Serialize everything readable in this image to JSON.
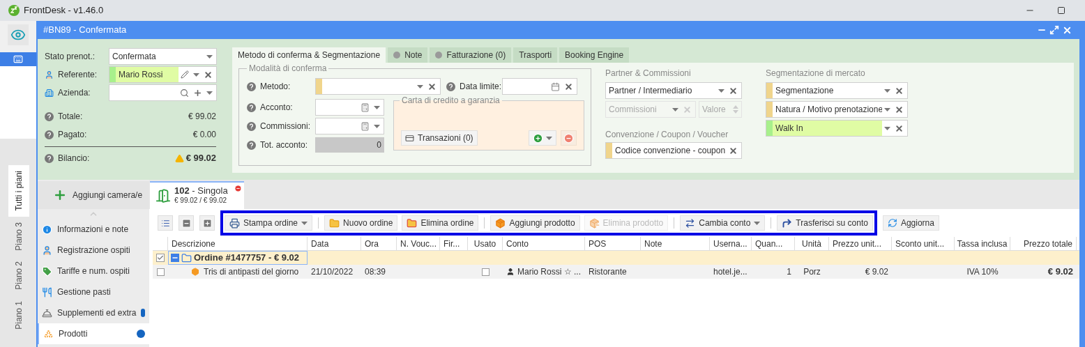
{
  "app": {
    "title": "FrontDesk - v1.46.0"
  },
  "floors": [
    {
      "label": "Tutti i piani",
      "selected": true
    },
    {
      "label": "Piano 3",
      "selected": false
    },
    {
      "label": "Piano 2",
      "selected": false
    },
    {
      "label": "Piano 1",
      "selected": false
    }
  ],
  "dialog": {
    "title": "#BN89 - Confermata"
  },
  "booking": {
    "status": {
      "label": "Stato prenot.:",
      "value": "Confermata"
    },
    "referente": {
      "label": "Referente:",
      "value": "Mario Rossi",
      "color": "#a8f08c"
    },
    "azienda": {
      "label": "Azienda:"
    },
    "totals": [
      {
        "label": "Totale:",
        "value": "€ 99.02"
      },
      {
        "label": "Pagato:",
        "value": "€ 0.00"
      }
    ],
    "balance": {
      "label": "Bilancio:",
      "value": "€ 99.02",
      "warning": true
    }
  },
  "tabs": [
    {
      "label": "Metodo di conferma & Segmentazione",
      "selected": true,
      "dot": false
    },
    {
      "label": "Note",
      "selected": false,
      "dot": true
    },
    {
      "label": "Fatturazione (0)",
      "selected": false,
      "dot": true
    },
    {
      "label": "Trasporti",
      "selected": false,
      "dot": false
    },
    {
      "label": "Booking Engine",
      "selected": false,
      "dot": false
    }
  ],
  "conferma": {
    "title": "Modalità di conferma",
    "metodo": {
      "label": "Metodo:",
      "color": "#f0d58c"
    },
    "data_limite": {
      "label": "Data limite:"
    },
    "acconto": {
      "label": "Acconto:"
    },
    "commissioni": {
      "label": "Commissioni:"
    },
    "tot_acconto": {
      "label": "Tot. acconto:",
      "value": "0"
    },
    "carta": {
      "title": "Carta di credito a garanzia",
      "transactions": "Transazioni (0)"
    }
  },
  "partner": {
    "title": "Partner & Commissioni",
    "partner": {
      "value": "Partner / Intermediario"
    },
    "commissioni": {
      "value": "Commissioni",
      "disabled": true
    },
    "valore": {
      "value": "Valore",
      "disabled": true
    }
  },
  "convenzione": {
    "title": "Convenzione / Coupon / Voucher",
    "code": {
      "value": "Codice convenzione - coupon",
      "color": "#f0d58c"
    }
  },
  "segmentazione": {
    "title": "Segmentazione di mercato",
    "fields": [
      {
        "value": "Segmentazione",
        "color": "#f0d58c",
        "highlighted": false
      },
      {
        "value": "Natura / Motivo prenotazione",
        "color": "#f0d58c",
        "highlighted": false
      },
      {
        "value": "Walk In",
        "color": "#a8f08c",
        "highlighted": true
      }
    ]
  },
  "sidebar": {
    "add_button": "Aggiungi camera/e",
    "items": [
      {
        "label": "Informazioni e note",
        "selected": false,
        "dot": false
      },
      {
        "label": "Registrazione ospiti",
        "selected": false,
        "dot": false
      },
      {
        "label": "Tariffe e num. ospiti",
        "selected": false,
        "dot": false
      },
      {
        "label": "Gestione pasti",
        "selected": false,
        "dot": false
      },
      {
        "label": "Supplementi ed extra",
        "selected": false,
        "dot": true
      },
      {
        "label": "Prodotti",
        "selected": true,
        "dot": true
      }
    ]
  },
  "room": {
    "title": "**102** - Singola",
    "amounts": "€ 99.02 / € 99.02"
  },
  "toolbar": {
    "groups": [
      [
        {
          "label": "Stampa ordine",
          "menu": true,
          "disabled": false
        }
      ],
      [
        {
          "label": "Nuovo ordine",
          "menu": false,
          "disabled": false
        },
        {
          "label": "Elimina ordine",
          "menu": false,
          "disabled": false
        }
      ],
      [
        {
          "label": "Aggiungi prodotto",
          "menu": false,
          "disabled": false
        },
        {
          "label": "Elimina prodotto",
          "menu": false,
          "disabled": true
        }
      ],
      [
        {
          "label": "Cambia conto",
          "menu": true,
          "disabled": false
        }
      ],
      [
        {
          "label": "Trasferisci su conto",
          "menu": false,
          "disabled": false
        }
      ]
    ],
    "refresh": "Aggiorna"
  },
  "table": {
    "columns": [
      "Descrizione",
      "Data",
      "Ora",
      "N. Vouc...",
      "Fir...",
      "Usato",
      "Conto",
      "POS",
      "Note",
      "Userna...",
      "Quan...",
      "Unità",
      "Prezzo unit...",
      "Sconto unit...",
      "Tassa inclusa",
      "Prezzo totale"
    ],
    "rows": [
      {
        "label": "Ordine #1477757 - € 9.02",
        "checked": true,
        "expanded": true,
        "children": [
          {
            "checked": false,
            "description": "Tris di antipasti del giorno",
            "date": "21/10/2022",
            "time": "08:39",
            "used": false,
            "account": "Mario Rossi ☆ ...",
            "pos": "Ristorante",
            "username": "hotel.je...",
            "quantity": "1",
            "unit": "Porz",
            "unit_price": "€ 9.02",
            "tax": "IVA 10%",
            "total": "€ 9.02"
          }
        ]
      }
    ]
  }
}
